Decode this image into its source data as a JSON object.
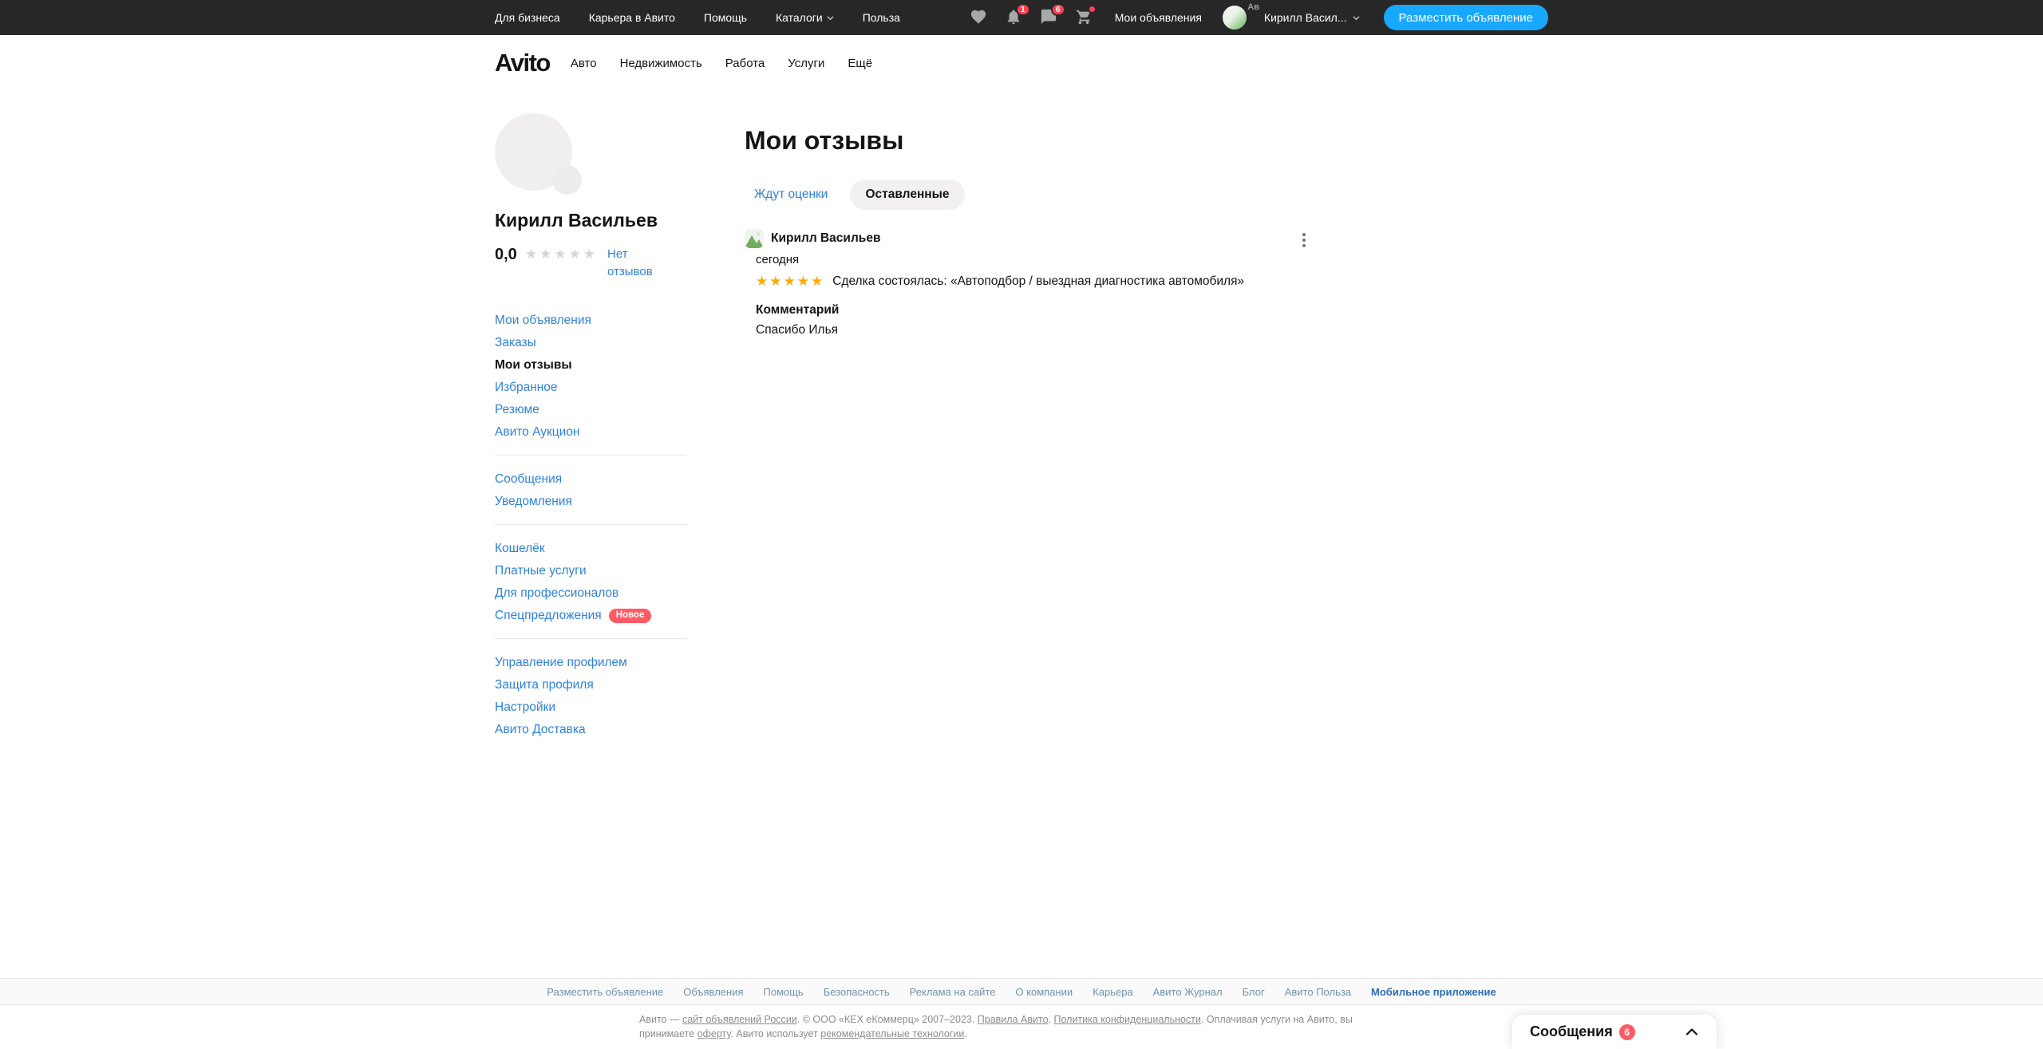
{
  "colors": {
    "topbar_bg": "#272727",
    "accent_button": "#19a8ff",
    "link_blue": "#2f82d7",
    "badge_red": "#ff4053",
    "new_badge_red": "#ff5b66",
    "star_orange": "#ffaa00",
    "star_empty": "#d6d5d3",
    "footer_link": "#6f92b3"
  },
  "topbar": {
    "links": [
      {
        "label": "Для бизнеса"
      },
      {
        "label": "Карьера в Авито"
      },
      {
        "label": "Помощь"
      },
      {
        "label": "Каталоги",
        "has_caret": true
      },
      {
        "label": "Польза"
      }
    ],
    "icons": [
      {
        "name": "heart-icon"
      },
      {
        "name": "bell-icon",
        "badge": "1"
      },
      {
        "name": "chat-icon",
        "badge": "6"
      },
      {
        "name": "cart-icon",
        "badge_dot": true
      }
    ],
    "my_ads_label": "Мои объявления",
    "avatar_label": "Ав",
    "user_name": "Кирилл Васил...",
    "post_button_label": "Разместить объявление"
  },
  "subheader": {
    "logo": "Avito",
    "links": [
      {
        "label": "Авто"
      },
      {
        "label": "Недвижимость"
      },
      {
        "label": "Работа"
      },
      {
        "label": "Услуги"
      },
      {
        "label": "Ещё"
      }
    ]
  },
  "profile": {
    "name": "Кирилл Васильев",
    "rating_value": "0,0",
    "stars_display": "★★★★★",
    "no_reviews_link": "Нет отзывов"
  },
  "sidebar": {
    "groups": [
      {
        "items": [
          {
            "label": "Мои объявления"
          },
          {
            "label": "Заказы"
          },
          {
            "label": "Мои отзывы",
            "active": true
          },
          {
            "label": "Избранное"
          },
          {
            "label": "Резюме"
          },
          {
            "label": "Авито Аукцион"
          }
        ]
      },
      {
        "items": [
          {
            "label": "Сообщения"
          },
          {
            "label": "Уведомления"
          }
        ]
      },
      {
        "items": [
          {
            "label": "Кошелёк"
          },
          {
            "label": "Платные услуги"
          },
          {
            "label": "Для профессионалов"
          },
          {
            "label": "Спецпредложения",
            "badge": "Новое"
          }
        ]
      },
      {
        "items": [
          {
            "label": "Управление профилем"
          },
          {
            "label": "Защита профиля"
          },
          {
            "label": "Настройки"
          },
          {
            "label": "Авито Доставка"
          }
        ]
      }
    ]
  },
  "main": {
    "title": "Мои отзывы",
    "tabs": [
      {
        "label": "Ждут оценки"
      },
      {
        "label": "Оставленные",
        "active": true
      }
    ]
  },
  "review": {
    "author": "Кирилл Васильев",
    "date": "сегодня",
    "stars_display": "★★★★★",
    "rating": 5,
    "deal_text": "Сделка состоялась: «Автоподбор / выездная диагностика автомобиля»",
    "comment_label": "Комментарий",
    "comment": "Спасибо Илья"
  },
  "footer": {
    "links": [
      {
        "label": "Разместить объявление"
      },
      {
        "label": "Объявления"
      },
      {
        "label": "Помощь"
      },
      {
        "label": "Безопасность"
      },
      {
        "label": "Реклама на сайте"
      },
      {
        "label": "О компании"
      },
      {
        "label": "Карьера"
      },
      {
        "label": "Авито Журнал"
      },
      {
        "label": "Блог"
      },
      {
        "label": "Авито Польза"
      },
      {
        "label": "Мобильное приложение",
        "strong": true
      }
    ],
    "legal": {
      "t1": "Авито — ",
      "l1": "сайт объявлений России",
      "t2": ". © ООО «КЕХ еКоммерц» 2007–2023. ",
      "l2": "Правила Авито",
      "t3": ". ",
      "l3": "Политика конфиденциальности",
      "t4": ". Оплачивая услуги на Авито, вы принимаете ",
      "l4": "оферту",
      "t5": ". Авито использует ",
      "l5": "рекомендательные технологии",
      "t6": "."
    }
  },
  "messenger": {
    "label": "Сообщения",
    "badge": "6"
  }
}
